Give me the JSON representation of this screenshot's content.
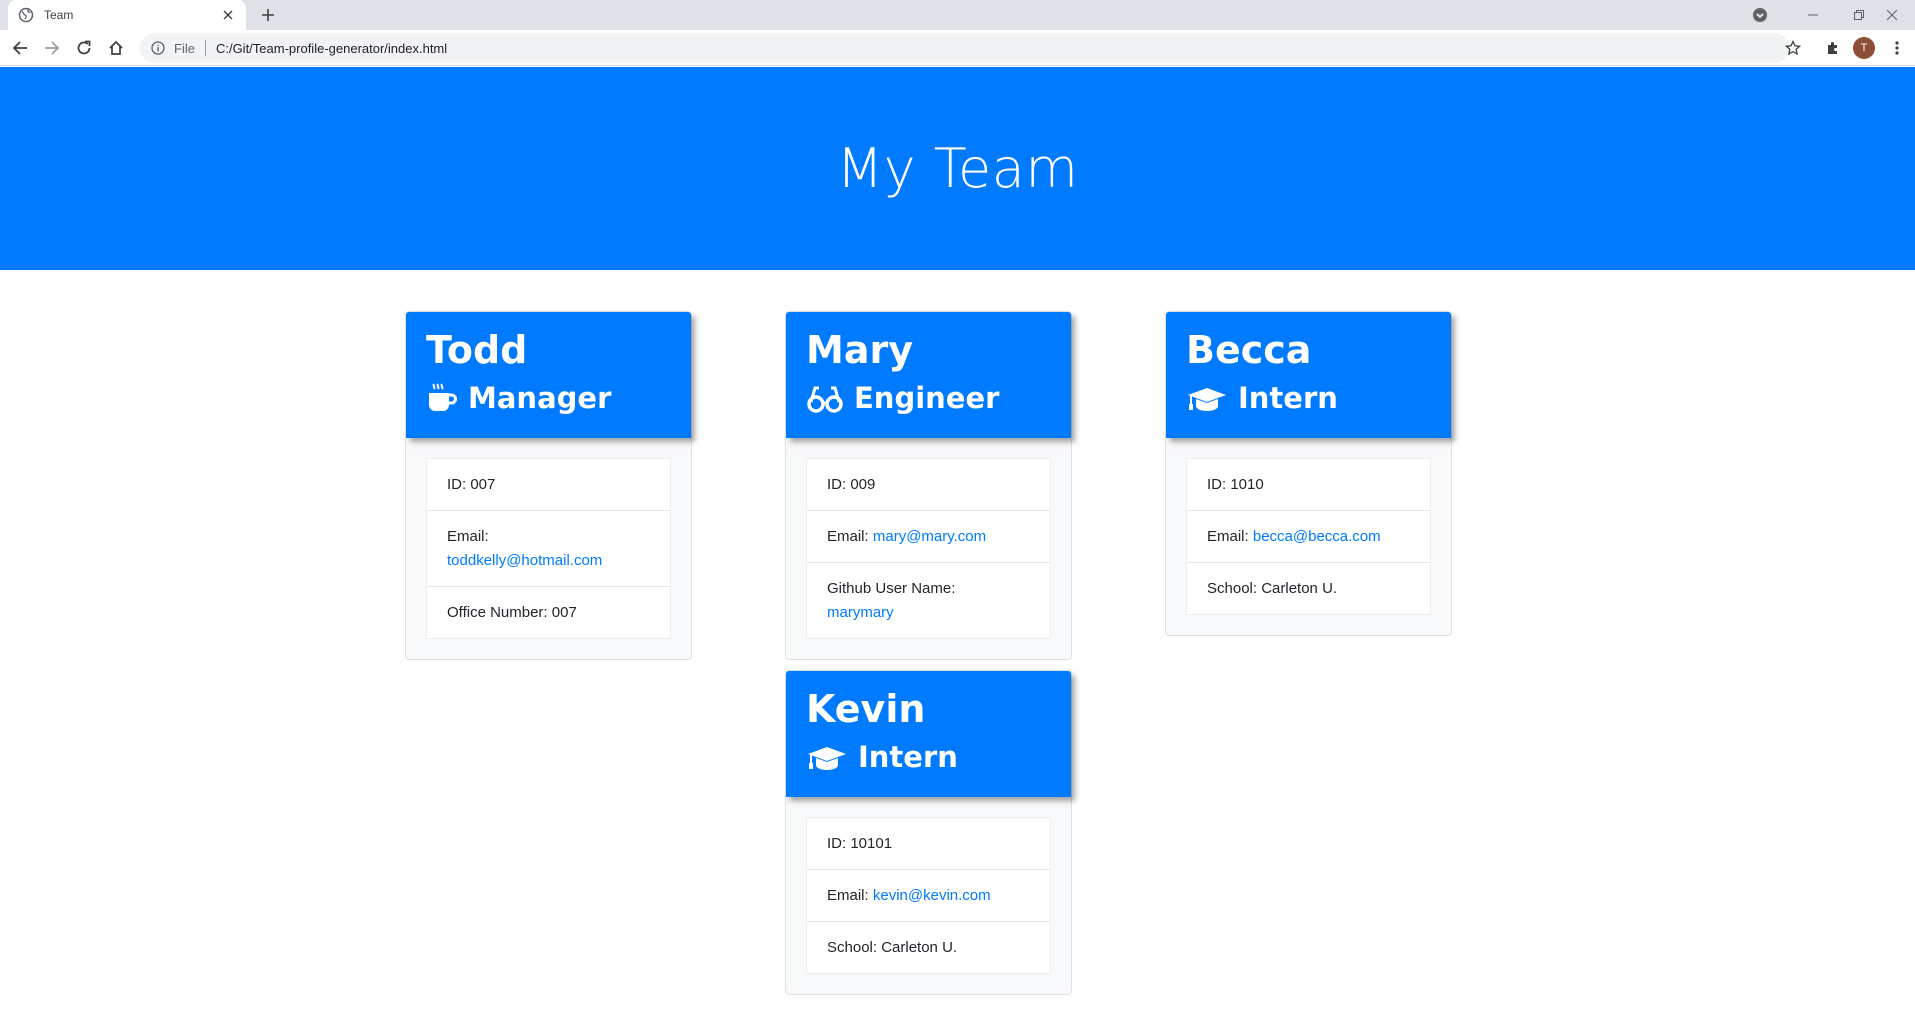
{
  "browser": {
    "tab_title": "Team",
    "url_scheme_label": "File",
    "url": "C:/Git/Team-profile-generator/index.html",
    "avatar_letter": "T"
  },
  "page": {
    "heading": "My Team"
  },
  "cards": [
    {
      "name": "Todd",
      "role": "Manager",
      "role_icon": "mug-icon",
      "id_text": "ID: 007",
      "email_label": "Email:",
      "email": "toddkelly@hotmail.com",
      "extra_label": "Office Number: 007",
      "extra_value": ""
    },
    {
      "name": "Mary",
      "role": "Engineer",
      "role_icon": "glasses-icon",
      "id_text": "ID: 009",
      "email_label": "Email:",
      "email": "mary@mary.com",
      "extra_label": "Github User Name:",
      "extra_value": "marymary"
    },
    {
      "name": "Becca",
      "role": "Intern",
      "role_icon": "graduation-cap-icon",
      "id_text": "ID: 1010",
      "email_label": "Email:",
      "email": "becca@becca.com",
      "extra_label": "School: Carleton U.",
      "extra_value": ""
    },
    {
      "name": "Kevin",
      "role": "Intern",
      "role_icon": "graduation-cap-icon",
      "id_text": "ID: 10101",
      "email_label": "Email:",
      "email": "kevin@kevin.com",
      "extra_label": "School: Carleton U.",
      "extra_value": ""
    }
  ],
  "colors": {
    "primary": "#007bff",
    "card_bg": "#f8f9fa",
    "link": "#007bff"
  }
}
